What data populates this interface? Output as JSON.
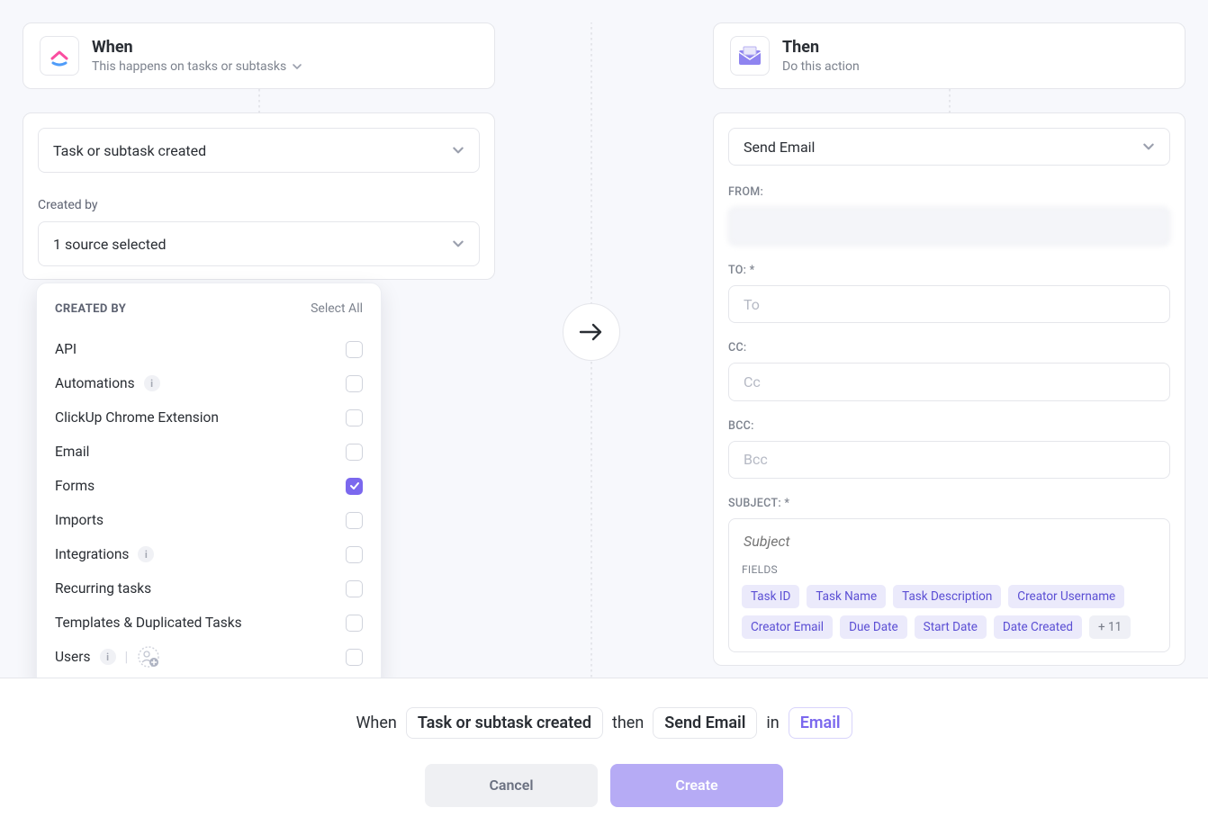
{
  "when": {
    "title": "When",
    "subtitle": "This happens on tasks or subtasks",
    "trigger": "Task or subtask created",
    "createdByLabel": "Created by",
    "sourceSummary": "1 source selected"
  },
  "then": {
    "title": "Then",
    "subtitle": "Do this action",
    "action": "Send Email",
    "fromLabel": "FROM:",
    "fromValue": "",
    "toLabel": "TO: *",
    "toPlaceholder": "To",
    "ccLabel": "CC:",
    "ccPlaceholder": "Cc",
    "bccLabel": "BCC:",
    "bccPlaceholder": "Bcc",
    "subjectLabel": "SUBJECT: *",
    "subjectPlaceholder": "Subject",
    "fieldsHeading": "FIELDS",
    "chips": [
      "Task ID",
      "Task Name",
      "Task Description",
      "Creator Username",
      "Creator Email",
      "Due Date",
      "Start Date",
      "Date Created"
    ],
    "moreChip": "+ 11"
  },
  "popover": {
    "title": "CREATED BY",
    "selectAll": "Select All",
    "rows": [
      {
        "label": "API",
        "checked": false,
        "info": false,
        "users": false
      },
      {
        "label": "Automations",
        "checked": false,
        "info": true,
        "users": false
      },
      {
        "label": "ClickUp Chrome Extension",
        "checked": false,
        "info": false,
        "users": false
      },
      {
        "label": "Email",
        "checked": false,
        "info": false,
        "users": false
      },
      {
        "label": "Forms",
        "checked": true,
        "info": false,
        "users": false
      },
      {
        "label": "Imports",
        "checked": false,
        "info": false,
        "users": false
      },
      {
        "label": "Integrations",
        "checked": false,
        "info": true,
        "users": false
      },
      {
        "label": "Recurring tasks",
        "checked": false,
        "info": false,
        "users": false
      },
      {
        "label": "Templates & Duplicated Tasks",
        "checked": false,
        "info": false,
        "users": false
      },
      {
        "label": "Users",
        "checked": false,
        "info": true,
        "users": true
      }
    ]
  },
  "footer": {
    "whenWord": "When",
    "trigger": "Task or subtask created",
    "thenWord": "then",
    "action": "Send Email",
    "inWord": "in",
    "target": "Email",
    "cancel": "Cancel",
    "create": "Create"
  }
}
